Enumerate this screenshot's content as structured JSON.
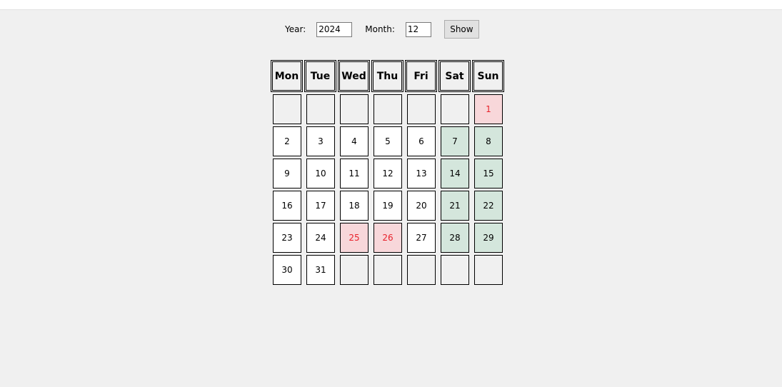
{
  "controls": {
    "year_label": "Year:",
    "year_value": "2024",
    "month_label": "Month:",
    "month_value": "12",
    "show_label": "Show"
  },
  "calendar": {
    "weekdays": [
      "Mon",
      "Tue",
      "Wed",
      "Thu",
      "Fri",
      "Sat",
      "Sun"
    ],
    "weeks": [
      [
        {
          "t": "",
          "k": "empty"
        },
        {
          "t": "",
          "k": "empty"
        },
        {
          "t": "",
          "k": "empty"
        },
        {
          "t": "",
          "k": "empty"
        },
        {
          "t": "",
          "k": "empty"
        },
        {
          "t": "",
          "k": "empty"
        },
        {
          "t": "1",
          "k": "holiday"
        }
      ],
      [
        {
          "t": "2",
          "k": "normal"
        },
        {
          "t": "3",
          "k": "normal"
        },
        {
          "t": "4",
          "k": "normal"
        },
        {
          "t": "5",
          "k": "normal"
        },
        {
          "t": "6",
          "k": "normal"
        },
        {
          "t": "7",
          "k": "weekend"
        },
        {
          "t": "8",
          "k": "weekend"
        }
      ],
      [
        {
          "t": "9",
          "k": "normal"
        },
        {
          "t": "10",
          "k": "normal"
        },
        {
          "t": "11",
          "k": "normal"
        },
        {
          "t": "12",
          "k": "normal"
        },
        {
          "t": "13",
          "k": "normal"
        },
        {
          "t": "14",
          "k": "weekend"
        },
        {
          "t": "15",
          "k": "weekend"
        }
      ],
      [
        {
          "t": "16",
          "k": "normal"
        },
        {
          "t": "17",
          "k": "normal"
        },
        {
          "t": "18",
          "k": "normal"
        },
        {
          "t": "19",
          "k": "normal"
        },
        {
          "t": "20",
          "k": "normal"
        },
        {
          "t": "21",
          "k": "weekend"
        },
        {
          "t": "22",
          "k": "weekend"
        }
      ],
      [
        {
          "t": "23",
          "k": "normal"
        },
        {
          "t": "24",
          "k": "normal"
        },
        {
          "t": "25",
          "k": "holiday"
        },
        {
          "t": "26",
          "k": "holiday"
        },
        {
          "t": "27",
          "k": "normal"
        },
        {
          "t": "28",
          "k": "weekend"
        },
        {
          "t": "29",
          "k": "weekend"
        }
      ],
      [
        {
          "t": "30",
          "k": "normal"
        },
        {
          "t": "31",
          "k": "normal"
        },
        {
          "t": "",
          "k": "empty"
        },
        {
          "t": "",
          "k": "empty"
        },
        {
          "t": "",
          "k": "empty"
        },
        {
          "t": "",
          "k": "empty"
        },
        {
          "t": "",
          "k": "empty"
        }
      ]
    ]
  },
  "colors": {
    "background": "#f0f0f0",
    "weekend_fill": "#d4e6dc",
    "holiday_fill": "#f8d7da",
    "holiday_text": "#e8202a"
  }
}
